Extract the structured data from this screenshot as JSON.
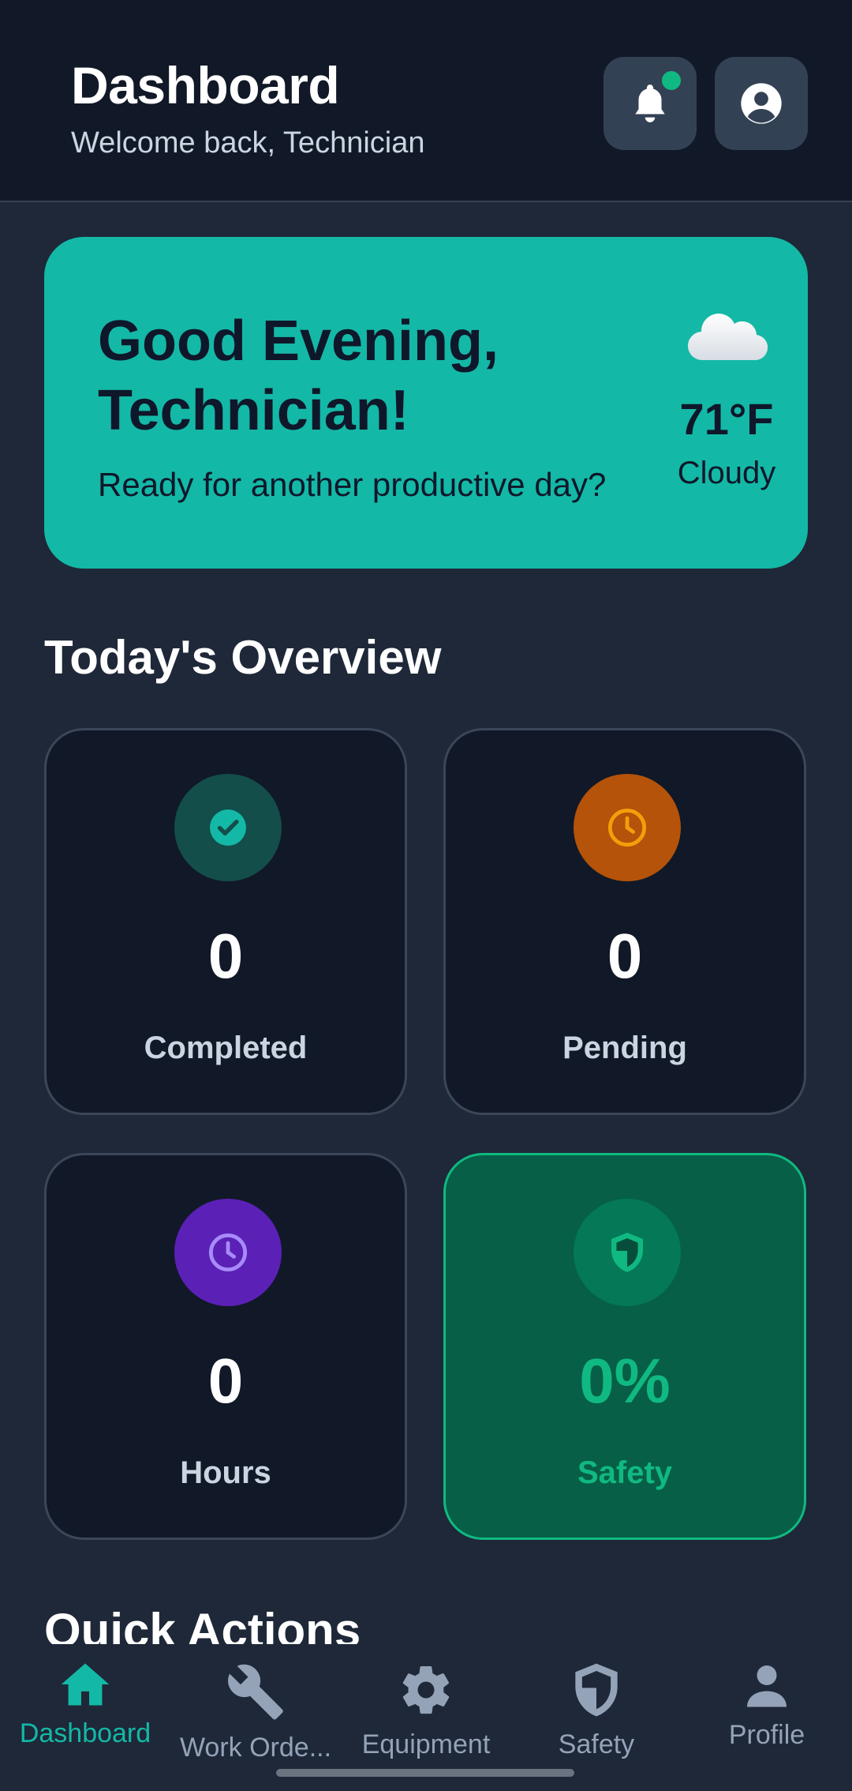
{
  "header": {
    "title": "Dashboard",
    "subtitle": "Welcome back, Technician",
    "notification_icon": "bell-icon",
    "profile_icon": "user-circle-icon"
  },
  "greeting": {
    "title": "Good Evening, Technician!",
    "subtitle": "Ready for another productive day?",
    "weather": {
      "icon": "cloud-icon",
      "temperature": "71°F",
      "condition": "Cloudy"
    }
  },
  "overview": {
    "title": "Today's Overview",
    "stats": [
      {
        "icon": "check-circle-icon",
        "value": "0",
        "label": "Completed",
        "accent": "#14b8a6"
      },
      {
        "icon": "clock-icon",
        "value": "0",
        "label": "Pending",
        "accent": "#f59e0b"
      },
      {
        "icon": "clock-icon",
        "value": "0",
        "label": "Hours",
        "accent": "#a78bfa"
      },
      {
        "icon": "shield-icon",
        "value": "0%",
        "label": "Safety",
        "accent": "#10b981"
      }
    ]
  },
  "quick_actions": {
    "title": "Quick Actions"
  },
  "bottom_nav": {
    "items": [
      {
        "label": "Dashboard",
        "icon": "home-icon",
        "active": true
      },
      {
        "label": "Work Orde...",
        "icon": "wrench-icon",
        "active": false
      },
      {
        "label": "Equipment",
        "icon": "gear-icon",
        "active": false
      },
      {
        "label": "Safety",
        "icon": "shield-icon",
        "active": false
      },
      {
        "label": "Profile",
        "icon": "person-icon",
        "active": false
      }
    ]
  },
  "colors": {
    "background": "#1e2838",
    "header": "#111827",
    "accent_teal": "#14b8a6",
    "success_green": "#10b981",
    "pending_orange": "#b45309",
    "hours_purple": "#5b21b6"
  }
}
